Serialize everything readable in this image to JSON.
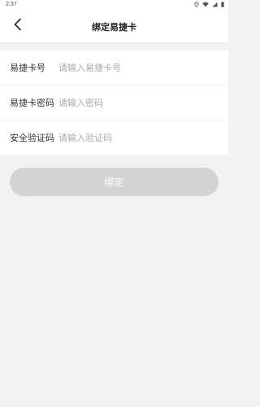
{
  "status_bar": {
    "time": "2:37"
  },
  "header": {
    "title": "绑定易捷卡",
    "back_icon": "chevron-left-icon"
  },
  "form": {
    "fields": [
      {
        "label": "易捷卡号",
        "placeholder": "请输入易捷卡号",
        "value": ""
      },
      {
        "label": "易捷卡密码",
        "placeholder": "请输入密码",
        "value": ""
      },
      {
        "label": "安全验证码",
        "placeholder": "请输入验证码",
        "value": ""
      }
    ]
  },
  "actions": {
    "bind_label": "绑定"
  },
  "colors": {
    "background": "#f2f2f2",
    "button_disabled": "#d3d3d3",
    "button_text": "#ffffff"
  }
}
